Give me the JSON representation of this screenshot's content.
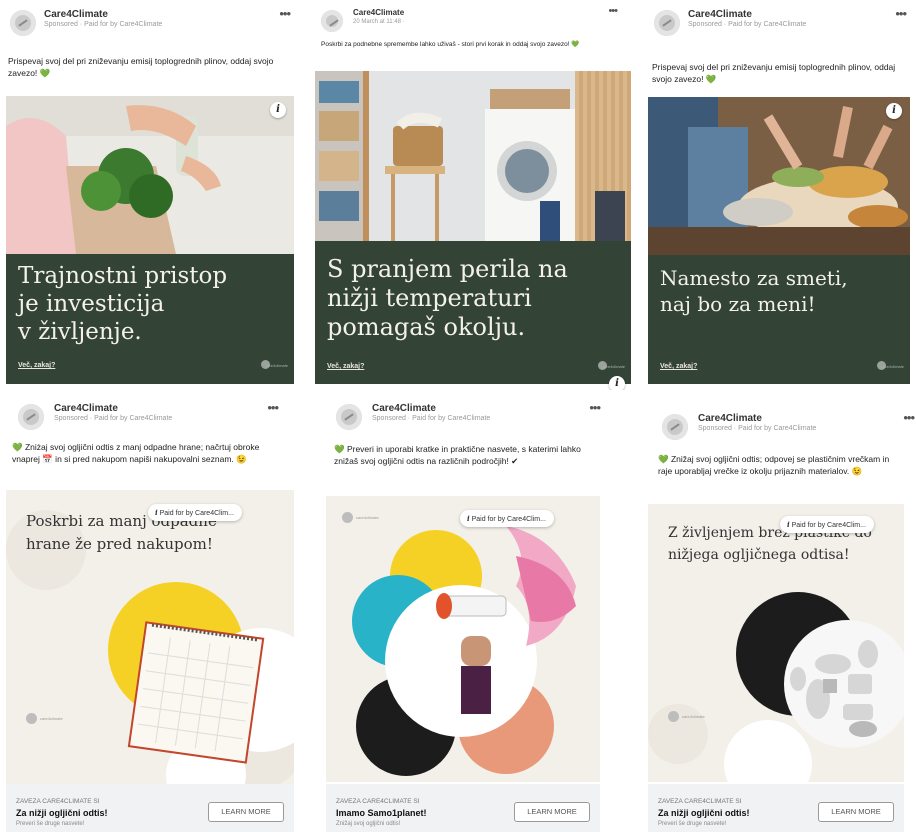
{
  "brand": "Care4Climate",
  "sponsored_line": "Sponsored · Paid for by Care4Climate",
  "date_line": "20 March at 11:48 · ",
  "more_label": "•••",
  "info_label": "i",
  "why_label": "Več, zakaj?",
  "mini_logo_text": "care4climate",
  "paid_pill": "Paid for by Care4Clim...",
  "learn_more": "LEARN MORE",
  "footer_top": "ZAVEZA CARE4CLIMATE SI",
  "ads": [
    {
      "caption": "Prispevaj svoj del pri zniževanju emisij toplogrednih plinov, oddaj svojo zavezo! 💚",
      "headline": [
        "Trajnostni pristop",
        "je investicija",
        "v življenje."
      ]
    },
    {
      "caption": "Poskrbi za podnebne spremembe lahko uživaš - stori prvi korak in oddaj svojo zavezo! 💚",
      "headline": [
        "S pranjem perila na",
        "nižji temperaturi",
        "pomagaš okolju."
      ]
    },
    {
      "caption": "Prispevaj svoj del pri zniževanju emisij toplogrednih plinov, oddaj svojo zavezo! 💚",
      "headline": [
        "Namesto za smeti,",
        "naj bo za meni!"
      ]
    },
    {
      "caption": "💚 Zniżaj svoj ogljični odtis z manj odpadne hrane; načrtuj obroke vnaprej 📅 in si pred nakupom napiši nakupovalni seznam. 😉",
      "title": [
        "Poskrbi za manj odpadne",
        "hrane že pred nakupom!"
      ],
      "footer_title": "Za nižji ogljični odtis!",
      "footer_sub": "Preveri še druge nasvete!"
    },
    {
      "caption": "💚 Preveri in uporabi kratke in praktične nasvete, s katerimi lahko znižaš svoj ogljični odtis na različnih področjih! ✔",
      "footer_title": "Imamo Samo1planet!",
      "footer_sub": "Znižaj svoj ogljični odtis!"
    },
    {
      "caption": "💚 Znižaj svoj ogljični odtis; odpovej se plastičnim vrečkam in raje uporabljaj vrečke iz okolju prijaznih materialov. 😉",
      "title": [
        "Z življenjem brez plastike do",
        "nižjega ogljičnega odtisa!"
      ],
      "footer_title": "Za nižji ogljični odtis!",
      "footer_sub": "Preveri še druge nasvete!"
    }
  ],
  "colors": {
    "panel_green": "#334437",
    "beige_bg": "#f3efe9",
    "yellow": "#f6d125",
    "cyan": "#28b3c9",
    "black": "#1c1c1c",
    "salmon": "#e8997a",
    "heart_green": "#44b33a"
  }
}
